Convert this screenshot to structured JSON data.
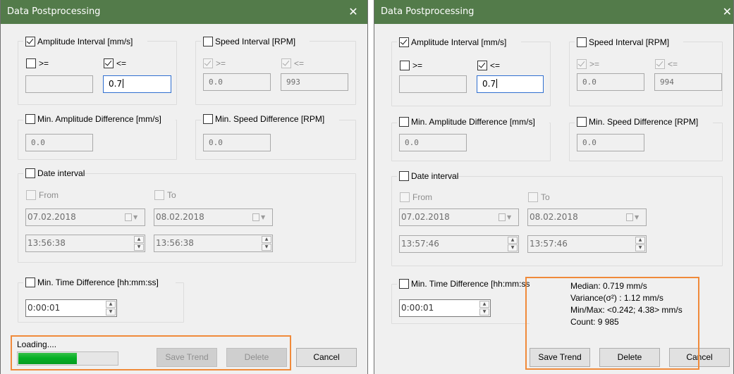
{
  "dialogs": [
    {
      "title": "Data Postprocessing",
      "close_glyph": "✕",
      "amplitude_interval": {
        "label": "Amplitude Interval [mm/s]",
        "checked": true,
        "ge_label": ">=",
        "ge_checked": false,
        "ge_value": "",
        "le_label": "<=",
        "le_checked": true,
        "le_value": "0.7"
      },
      "speed_interval": {
        "label": "Speed Interval [RPM]",
        "checked": false,
        "ge_label": ">=",
        "le_label": "<=",
        "ge_value": "0.0",
        "le_value": "993"
      },
      "min_amp_diff": {
        "label": "Min. Amplitude Difference [mm/s]",
        "checked": false,
        "value": "0.0"
      },
      "min_speed_diff": {
        "label": "Min. Speed Difference [RPM]",
        "checked": false,
        "value": "0.0"
      },
      "date_interval": {
        "label": "Date interval",
        "checked": false,
        "from_label": "From",
        "to_label": "To",
        "from_date": "07.02.2018",
        "to_date": "08.02.2018",
        "from_time": "13:56:38",
        "to_time": "13:56:38"
      },
      "min_time_diff": {
        "label": "Min. Time Difference [hh:mm:ss]",
        "checked": false,
        "value": "0:00:01"
      },
      "loading_text": "Loading....",
      "progress": 0.6,
      "buttons": {
        "save_trend": "Save Trend",
        "delete": "Delete",
        "cancel": "Cancel"
      }
    },
    {
      "title": "Data Postprocessing",
      "close_glyph": "✕",
      "amplitude_interval": {
        "label": "Amplitude Interval [mm/s]",
        "checked": true,
        "ge_label": ">=",
        "ge_checked": false,
        "ge_value": "",
        "le_label": "<=",
        "le_checked": true,
        "le_value": "0.7"
      },
      "speed_interval": {
        "label": "Speed Interval [RPM]",
        "checked": false,
        "ge_label": ">=",
        "le_label": "<=",
        "ge_value": "0.0",
        "le_value": "994"
      },
      "min_amp_diff": {
        "label": "Min. Amplitude Difference [mm/s]",
        "checked": false,
        "value": "0.0"
      },
      "min_speed_diff": {
        "label": "Min. Speed Difference [RPM]",
        "checked": false,
        "value": "0.0"
      },
      "date_interval": {
        "label": "Date interval",
        "checked": false,
        "from_label": "From",
        "to_label": "To",
        "from_date": "07.02.2018",
        "to_date": "08.02.2018",
        "from_time": "13:57:46",
        "to_time": "13:57:46"
      },
      "min_time_diff": {
        "label": "Min. Time Difference [hh:mm:ss]",
        "checked": false,
        "value": "0:00:01"
      },
      "stats": {
        "median": "Median: 0.719 mm/s",
        "variance": "Variance(σ²) : 1.12 mm/s",
        "minmax": "Min/Max: <0.242; 4.38> mm/s",
        "count": "Count: 9 985"
      },
      "buttons": {
        "save_trend": "Save Trend",
        "delete": "Delete",
        "cancel": "Cancel"
      }
    }
  ],
  "colors": {
    "titlebar": "#537b4a",
    "highlight": "#f08a3a",
    "progress": "#06b025"
  }
}
